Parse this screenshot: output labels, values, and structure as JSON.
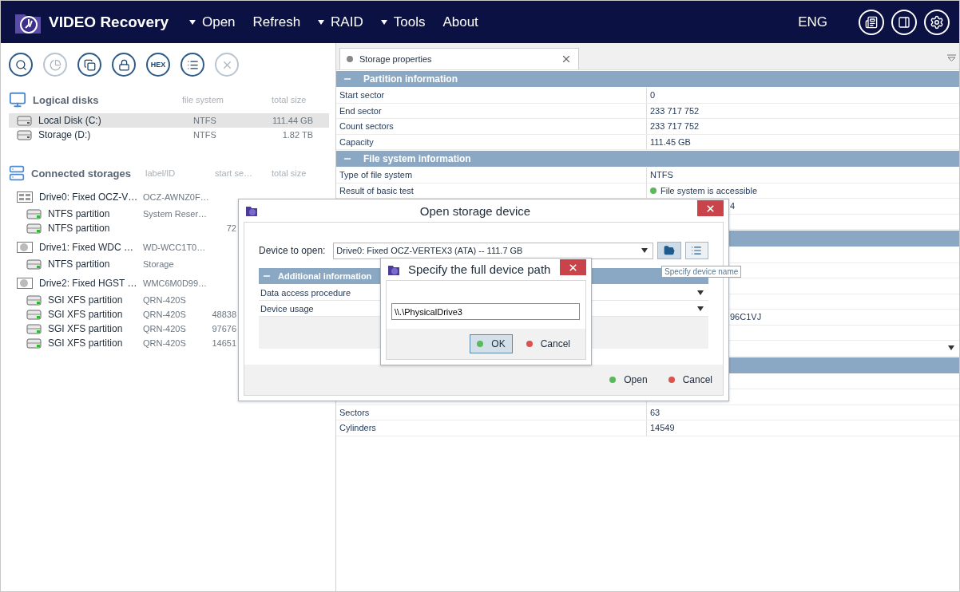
{
  "app": {
    "title": "VIDEO Recovery",
    "language": "ENG",
    "menu": [
      {
        "label": "Open",
        "dropdown": true
      },
      {
        "label": "Refresh",
        "dropdown": false
      },
      {
        "label": "RAID",
        "dropdown": true
      },
      {
        "label": "Tools",
        "dropdown": true
      },
      {
        "label": "About",
        "dropdown": false
      }
    ]
  },
  "toolbar": [
    {
      "disabled": false
    },
    {
      "disabled": true
    },
    {
      "disabled": false
    },
    {
      "disabled": false
    },
    {
      "label": "HEX",
      "disabled": false
    },
    {
      "disabled": false
    },
    {
      "disabled": true
    }
  ],
  "logical_disks": {
    "title": "Logical disks",
    "columns": [
      "file system",
      "total size"
    ],
    "items": [
      {
        "name": "Local Disk (C:)",
        "file_system": "NTFS",
        "total_size": "111.44 GB",
        "selected": true
      },
      {
        "name": "Storage (D:)",
        "file_system": "NTFS",
        "total_size": "1.82 TB",
        "selected": false
      }
    ]
  },
  "connected_storages": {
    "title": "Connected storages",
    "columns": [
      "label/ID",
      "start se…",
      "total size"
    ],
    "drives": [
      {
        "name": "Drive0: Fixed OCZ-V…",
        "label": "OCZ-AWNZ0F…",
        "kind": "ssd",
        "children": [
          {
            "name": "NTFS partition",
            "label": "System Reser…"
          },
          {
            "name": "NTFS partition",
            "start": "72"
          }
        ]
      },
      {
        "name": "Drive1: Fixed WDC …",
        "label": "WD-WCC1T0…",
        "kind": "hdd",
        "children": [
          {
            "name": "NTFS partition",
            "label": "Storage"
          }
        ]
      },
      {
        "name": "Drive2: Fixed HGST …",
        "label": "WMC6M0D99…",
        "kind": "hdd",
        "children": [
          {
            "name": "SGI XFS partition",
            "label": "QRN-420S"
          },
          {
            "name": "SGI XFS partition",
            "label": "QRN-420S",
            "start": "48838"
          },
          {
            "name": "SGI XFS partition",
            "label": "QRN-420S",
            "start": "97676"
          },
          {
            "name": "SGI XFS partition",
            "label": "QRN-420S",
            "start": "14651"
          }
        ]
      }
    ]
  },
  "tab": {
    "label": "Storage properties",
    "selected": true
  },
  "sections": [
    {
      "title": "Partition information",
      "expanded": true,
      "rows": [
        {
          "label": "Start sector",
          "value": "0"
        },
        {
          "label": "End sector",
          "value": "233 717 752"
        },
        {
          "label": "Count sectors",
          "value": "233 717 752"
        },
        {
          "label": "Capacity",
          "value": "111.45 GB"
        }
      ]
    },
    {
      "title": "File system information",
      "expanded": true,
      "rows": [
        {
          "label": "Type of file system",
          "value": "NTFS"
        },
        {
          "label": "Result of basic test",
          "value": "File system is accessible",
          "color": "#5cb85c"
        },
        {
          "value": "4"
        },
        {}
      ]
    },
    {
      "rows": [
        {},
        {},
        {},
        {},
        {
          "value": "96C1VJ"
        },
        {},
        {
          "dropdown": true
        }
      ]
    },
    {
      "rows": [
        {},
        {},
        {
          "label": "Sectors",
          "value": "63"
        },
        {
          "label": "Cylinders",
          "value": "14549"
        }
      ]
    }
  ],
  "open_dialog": {
    "title": "Open storage device",
    "device_label": "Device to open:",
    "device_value": "Drive0: Fixed OCZ-VERTEX3 (ATA) -- 111.7 GB",
    "tooltip": "Specify device name",
    "section": "Additional information",
    "rows": [
      "Data access procedure",
      "Device usage"
    ],
    "buttons": [
      {
        "label": "Open",
        "color": "#5cb85c"
      },
      {
        "label": "Cancel",
        "color": "#d9534f"
      }
    ]
  },
  "path_dialog": {
    "title": "Specify the full device path",
    "value": "\\\\.\\PhysicalDrive3",
    "buttons": [
      {
        "label": "OK",
        "color": "#5cb85c",
        "selected": true
      },
      {
        "label": "Cancel",
        "color": "#d9534f",
        "selected": false
      }
    ]
  }
}
